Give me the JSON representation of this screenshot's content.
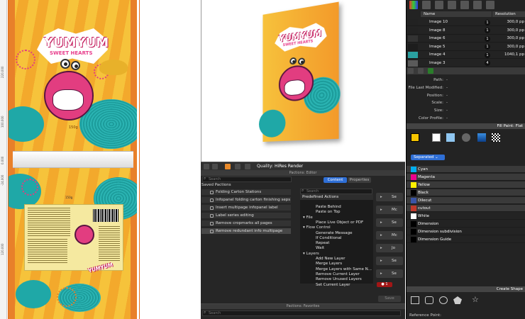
{
  "design": {
    "ruler_labels": [
      "220.000",
      "100.000",
      "0.000",
      "-24.000",
      "120.000"
    ],
    "brand_line1": "YUMYUM",
    "brand_line2": "SWEET HEARTS",
    "front_weight": "150g",
    "back_weight": "150g",
    "back_brand": "YUMYUM"
  },
  "preview": {
    "brand_line1": "YUMYUM",
    "brand_line2": "SWEET HEARTS"
  },
  "viewbar": {
    "quality_label": "Quality:",
    "quality_value": "HiRes Render"
  },
  "pitstop_editor": {
    "title": "Pactions: Editor",
    "search_placeholder": "Search",
    "saved_title": "Saved Pactions",
    "saved_items": [
      "Folding Carton Stations",
      "Infopanel folding carton finishing seps",
      "Insert multipage infopanel label",
      "Label series editing",
      "Remove cropmarks all pages",
      "Remove redundant info multipage"
    ],
    "tabs": [
      "Content",
      "Properties"
    ],
    "right_search_placeholder": "Search",
    "predefined_header": "Predefined Actions",
    "predefined": [
      {
        "label": "Paste Behind",
        "level": 1
      },
      {
        "label": "Paste on Top",
        "level": 1
      },
      {
        "label": "File",
        "level": 0
      },
      {
        "label": "Place Live Object or PDF",
        "level": 1
      },
      {
        "label": "Flow Control",
        "level": 0
      },
      {
        "label": "Generate Message",
        "level": 1
      },
      {
        "label": "If Conditional",
        "level": 1
      },
      {
        "label": "Repeat",
        "level": 1
      },
      {
        "label": "Wait",
        "level": 1
      },
      {
        "label": "Layers",
        "level": 0
      },
      {
        "label": "Add New Layer",
        "level": 1
      },
      {
        "label": "Merge Layers",
        "level": 1
      },
      {
        "label": "Merge Layers with Same N...",
        "level": 1
      },
      {
        "label": "Remove Current Layer",
        "level": 1
      },
      {
        "label": "Remove Unused Layers",
        "level": 1
      },
      {
        "label": "Set Current Layer",
        "level": 1
      }
    ],
    "action_cells": [
      "Se",
      "Mc",
      "Se",
      "Mc",
      "Jo",
      "Se",
      "Se"
    ],
    "record_count": "1",
    "save_label": "Save"
  },
  "pitstop_fav": {
    "title": "Pactions: Favorites",
    "search_placeholder": "Search"
  },
  "layers": {
    "col_name": "Name",
    "col_resolution": "Resolution",
    "rows": [
      {
        "name": "Image 10",
        "badge": "1",
        "res": "300,0 pp"
      },
      {
        "name": "Image 8",
        "badge": "1",
        "res": "300,0 pp"
      },
      {
        "name": "Image 6",
        "badge": "1",
        "res": "300,0 pp"
      },
      {
        "name": "Image 5",
        "badge": "1",
        "res": "300,0 pp"
      },
      {
        "name": "Image 4",
        "badge": "1",
        "res": "1040,1 pp"
      },
      {
        "name": "Image 3",
        "badge": "4",
        "res": ""
      }
    ]
  },
  "file_info": {
    "labels": [
      "Path:",
      "File Last Modified:",
      "Position:",
      "Scale:",
      "Size:",
      "Color Profile:"
    ],
    "values": [
      "-",
      "-",
      "-",
      "-",
      "-",
      "-"
    ]
  },
  "fill_paint": {
    "title": "Fill Paint: Flat",
    "mode": "Separated",
    "swatches": [
      {
        "name": "Cyan",
        "color": "#00aeef"
      },
      {
        "name": "Magenta",
        "color": "#ec008c"
      },
      {
        "name": "Yellow",
        "color": "#fff200"
      },
      {
        "name": "Black",
        "color": "#000000"
      },
      {
        "name": "Dilecut",
        "color": "#3a55a6"
      },
      {
        "name": "cutout",
        "color": "#c0392b"
      },
      {
        "name": "White",
        "color": "#ffffff"
      },
      {
        "name": "Dimension",
        "color": "#000000"
      },
      {
        "name": "Dimension subdivision",
        "color": "#000000"
      },
      {
        "name": "Dimension Guide",
        "color": "#000000"
      }
    ]
  },
  "create_shape": {
    "title": "Create Shape",
    "reference_label": "Reference Point:"
  }
}
